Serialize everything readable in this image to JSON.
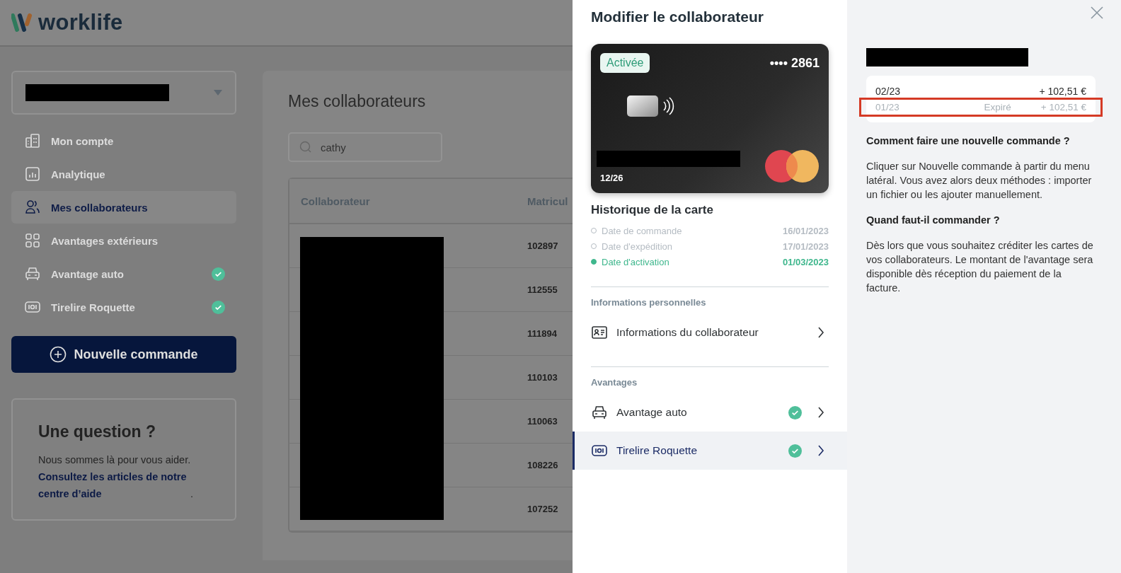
{
  "header": {
    "logo": "worklife"
  },
  "sidebar": {
    "items": [
      {
        "label": "Mon compte",
        "selected": false,
        "checked": false
      },
      {
        "label": "Analytique",
        "selected": false,
        "checked": false
      },
      {
        "label": "Mes collaborateurs",
        "selected": true,
        "checked": false
      },
      {
        "label": "Avantages extérieurs",
        "selected": false,
        "checked": false
      },
      {
        "label": "Avantage auto",
        "selected": false,
        "checked": true
      },
      {
        "label": "Tirelire Roquette",
        "selected": false,
        "checked": true
      }
    ],
    "new_order_button": "Nouvelle commande",
    "help": {
      "title": "Une question ?",
      "text": "Nous sommes là pour vous aider.",
      "link": "Consultez les articles de notre centre d’aide",
      "after_link": "."
    }
  },
  "main": {
    "title": "Mes collaborateurs",
    "search": {
      "value": "cathy"
    },
    "table": {
      "columns": [
        "Collaborateur",
        "Matricul"
      ],
      "rows": [
        {
          "matricule": "102897"
        },
        {
          "matricule": "112555"
        },
        {
          "matricule": "111894"
        },
        {
          "matricule": "110103"
        },
        {
          "matricule": "110063"
        },
        {
          "matricule": "108226"
        },
        {
          "matricule": "107252"
        }
      ]
    }
  },
  "modal": {
    "title": "Modifier le collaborateur",
    "card": {
      "status": "Activée",
      "number": "•••• 2861",
      "expiry": "12/26"
    },
    "history": {
      "title": "Historique de la carte",
      "events": [
        {
          "label": "Date de commande",
          "date": "16/01/2023",
          "active": false
        },
        {
          "label": "Date d'expédition",
          "date": "17/01/2023",
          "active": false
        },
        {
          "label": "Date d'activation",
          "date": "01/03/2023",
          "active": true
        }
      ]
    },
    "sections": [
      {
        "title": "Informations personnelles",
        "items": [
          {
            "label": "Informations du collaborateur",
            "checked": false,
            "selected": false
          }
        ]
      },
      {
        "title": "Avantages",
        "items": [
          {
            "label": "Avantage auto",
            "checked": true,
            "selected": false
          },
          {
            "label": "Tirelire Roquette",
            "checked": true,
            "selected": true
          }
        ]
      }
    ]
  },
  "side_panel": {
    "transactions": [
      {
        "period": "02/23",
        "amount": "+ 102,51 €",
        "expired": false,
        "highlighted": false
      },
      {
        "period": "01/23",
        "status": "Expiré",
        "amount": "+ 102,51 €",
        "expired": true,
        "highlighted": true
      }
    ],
    "faq": [
      {
        "question": "Comment faire une nouvelle commande ?",
        "answer": "Cliquer sur Nouvelle commande à partir du menu latéral. Vous avez alors deux méthodes : importer un fichier ou les ajouter manuellement."
      },
      {
        "question": "Quand faut-il commander ?",
        "answer": "Dès lors que vous souhaitez créditer les cartes de vos collaborateurs. Le montant de l'avantage sera disponible dès réception du paiement de la facture."
      }
    ]
  }
}
